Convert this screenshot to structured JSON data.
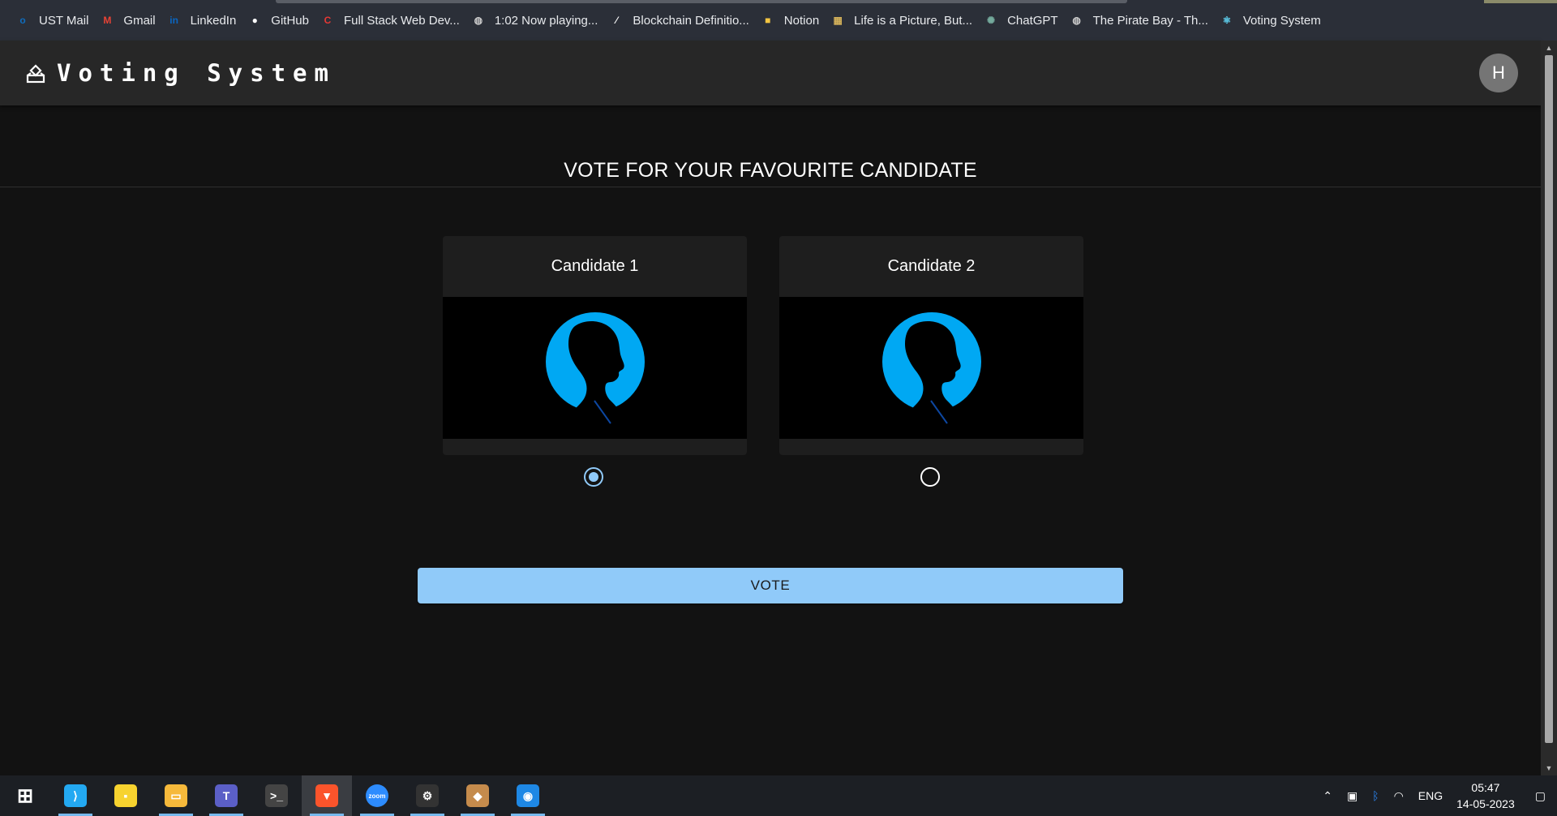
{
  "bookmarks": [
    {
      "label": "UST Mail",
      "icon": "outlook-icon",
      "color": "#0f6cbd",
      "glyph": "o"
    },
    {
      "label": "Gmail",
      "icon": "gmail-icon",
      "color": "#ea4335",
      "glyph": "M"
    },
    {
      "label": "LinkedIn",
      "icon": "linkedin-icon",
      "color": "#0a66c2",
      "glyph": "in"
    },
    {
      "label": "GitHub",
      "icon": "github-icon",
      "color": "#ffffff",
      "glyph": "●"
    },
    {
      "label": "Full Stack Web Dev...",
      "icon": "course-icon",
      "color": "#e53935",
      "glyph": "C"
    },
    {
      "label": "1:02 Now playing...",
      "icon": "globe-icon",
      "color": "#cccccc",
      "glyph": "◍"
    },
    {
      "label": "Blockchain Definitio...",
      "icon": "investopedia-icon",
      "color": "#ffffff",
      "glyph": "⁄"
    },
    {
      "label": "Notion",
      "icon": "folder-icon",
      "color": "#f4c542",
      "glyph": "■"
    },
    {
      "label": "Life is a Picture, But...",
      "icon": "picture-icon",
      "color": "#d4b15a",
      "glyph": "▦"
    },
    {
      "label": "ChatGPT",
      "icon": "chatgpt-icon",
      "color": "#74aa9c",
      "glyph": "✺"
    },
    {
      "label": "The Pirate Bay - Th...",
      "icon": "globe-icon",
      "color": "#cccccc",
      "glyph": "◍"
    },
    {
      "label": "Voting System",
      "icon": "react-icon",
      "color": "#61dafb",
      "glyph": "⚛"
    }
  ],
  "app": {
    "title": "Voting System",
    "avatar_letter": "H"
  },
  "main": {
    "heading": "VOTE FOR YOUR FAVOURITE CANDIDATE",
    "candidates": [
      {
        "name": "Candidate 1",
        "selected": true
      },
      {
        "name": "Candidate 2",
        "selected": false
      }
    ],
    "vote_label": "VOTE"
  },
  "colors": {
    "accent": "#90caf9",
    "silhouette": "#00a8f3",
    "background": "#121212",
    "appbar": "#272727"
  },
  "taskbar": {
    "apps": [
      {
        "name": "start-icon",
        "color": "#ffffff",
        "glyph": "⊞"
      },
      {
        "name": "vscode-icon",
        "color": "#23a9f2",
        "glyph": "⟩"
      },
      {
        "name": "sticky-notes-icon",
        "color": "#f7d32f",
        "glyph": "▪"
      },
      {
        "name": "file-explorer-icon",
        "color": "#f6b93b",
        "glyph": "▭"
      },
      {
        "name": "teams-icon",
        "color": "#5b5fc7",
        "glyph": "T"
      },
      {
        "name": "terminal-icon",
        "color": "#444444",
        "glyph": ">_"
      },
      {
        "name": "brave-icon",
        "color": "#fb542b",
        "glyph": "▼"
      },
      {
        "name": "zoom-icon",
        "color": "#2d8cff",
        "glyph": "zoom"
      },
      {
        "name": "settings-icon",
        "color": "#333333",
        "glyph": "⚙"
      },
      {
        "name": "minecraft-icon",
        "color": "#c58b4c",
        "glyph": "◆"
      },
      {
        "name": "camera-icon",
        "color": "#1e88e5",
        "glyph": "◉"
      }
    ],
    "tray_lang": "ENG",
    "time": "05:47",
    "date": "14-05-2023"
  }
}
